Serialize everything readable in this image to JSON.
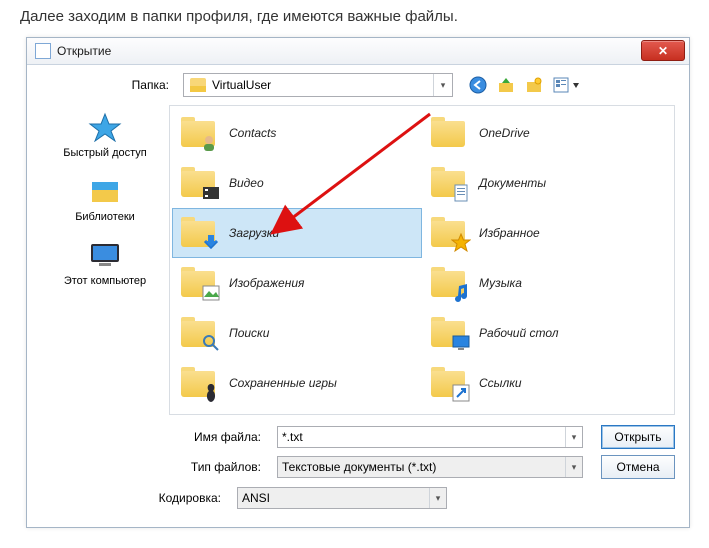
{
  "caption": "Далее заходим в папки профиля, где имеются важные файлы.",
  "title": "Открытие",
  "close_glyph": "✕",
  "folder_label": "Папка:",
  "folder_value": "VirtualUser",
  "toolbar": {
    "back_icon": "back-icon",
    "up_icon": "up-icon",
    "newfolder_icon": "new-folder-icon",
    "views_icon": "views-icon"
  },
  "sidebar": [
    {
      "label": "Быстрый доступ",
      "icon": "star"
    },
    {
      "label": "Библиотеки",
      "icon": "libraries"
    },
    {
      "label": "Этот компьютер",
      "icon": "computer"
    }
  ],
  "items_left": [
    {
      "label": "Contacts",
      "overlay": "contacts"
    },
    {
      "label": "Видео",
      "overlay": "video"
    },
    {
      "label": "Загрузки",
      "overlay": "download",
      "selected": true
    },
    {
      "label": "Изображения",
      "overlay": "image"
    },
    {
      "label": "Поиски",
      "overlay": "search"
    },
    {
      "label": "Сохраненные игры",
      "overlay": "games"
    }
  ],
  "items_right": [
    {
      "label": "OneDrive",
      "overlay": ""
    },
    {
      "label": "Документы",
      "overlay": "doc"
    },
    {
      "label": "Избранное",
      "overlay": "star"
    },
    {
      "label": "Музыка",
      "overlay": "music"
    },
    {
      "label": "Рабочий стол",
      "overlay": "desktop"
    },
    {
      "label": "Ссылки",
      "overlay": "link"
    }
  ],
  "filename_label": "Имя файла:",
  "filename_value": "*.txt",
  "filetype_label": "Тип файлов:",
  "filetype_value": "Текстовые документы (*.txt)",
  "encoding_label": "Кодировка:",
  "encoding_value": "ANSI",
  "open_btn": "Открыть",
  "cancel_btn": "Отмена"
}
